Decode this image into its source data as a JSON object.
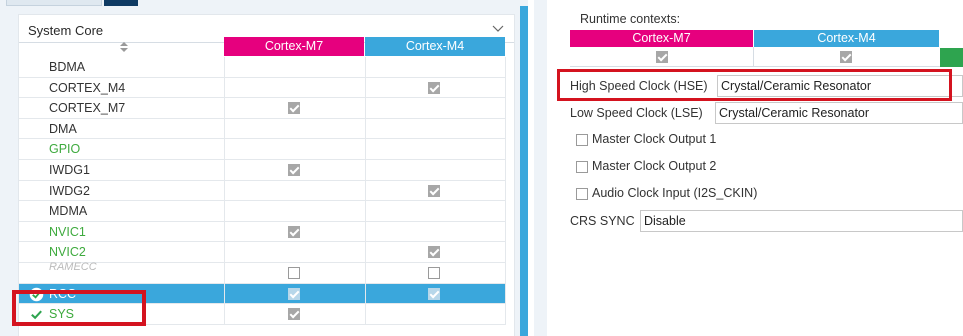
{
  "system_core": {
    "title": "System Core",
    "columns": [
      "Cortex-M7",
      "Cortex-M4"
    ],
    "rows": [
      {
        "name": "BDMA",
        "status": "normal",
        "m7": null,
        "m4": null
      },
      {
        "name": "CORTEX_M4",
        "status": "normal",
        "m7": null,
        "m4": "checked"
      },
      {
        "name": "CORTEX_M7",
        "status": "normal",
        "m7": "checked",
        "m4": null
      },
      {
        "name": "DMA",
        "status": "normal",
        "m7": null,
        "m4": null
      },
      {
        "name": "GPIO",
        "status": "configured",
        "m7": null,
        "m4": null
      },
      {
        "name": "IWDG1",
        "status": "normal",
        "m7": "checked",
        "m4": null
      },
      {
        "name": "IWDG2",
        "status": "normal",
        "m7": null,
        "m4": "checked"
      },
      {
        "name": "MDMA",
        "status": "normal",
        "m7": null,
        "m4": null
      },
      {
        "name": "NVIC1",
        "status": "configured",
        "m7": "checked",
        "m4": null
      },
      {
        "name": "NVIC2",
        "status": "configured",
        "m7": null,
        "m4": "checked"
      },
      {
        "name": "RAMECC",
        "status": "disabled",
        "m7": "unchecked",
        "m4": "unchecked"
      },
      {
        "name": "RCC",
        "status": "selected",
        "m7": "checked",
        "m4": "checked"
      },
      {
        "name": "SYS",
        "status": "configured",
        "m7": "checked",
        "m4": null
      }
    ]
  },
  "runtime": {
    "label": "Runtime contexts:",
    "columns": [
      "Cortex-M7",
      "Cortex-M4"
    ],
    "m7": "checked",
    "m4": "checked"
  },
  "hse": {
    "label": "High Speed Clock (HSE)",
    "value": "Crystal/Ceramic Resonator"
  },
  "lse": {
    "label": "Low Speed Clock (LSE)",
    "value": "Crystal/Ceramic Resonator"
  },
  "options": [
    {
      "label": "Master Clock Output 1",
      "checked": false
    },
    {
      "label": "Master Clock Output 2",
      "checked": false
    },
    {
      "label": "Audio Clock Input (I2S_CKIN)",
      "checked": false
    }
  ],
  "crs_sync": {
    "label": "CRS SYNC",
    "value": "Disable"
  },
  "colors": {
    "cortex_m7": "#e6007e",
    "cortex_m4": "#3aa7dc",
    "configured_text": "#3eaa3e",
    "highlight": "#d4131f",
    "selected_row": "#3aa7dc"
  },
  "icons": {
    "collapse": "chevron-up-icon",
    "sort": "sort-icon",
    "ok": "check-circle-icon"
  }
}
